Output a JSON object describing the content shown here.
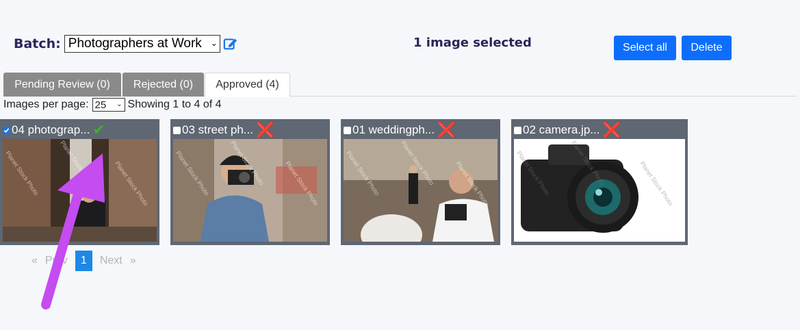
{
  "batch": {
    "label": "Batch:",
    "selected": "Photographers at Work"
  },
  "selection": {
    "status": "1 image selected"
  },
  "toolbar": {
    "select_all": "Select all",
    "delete": "Delete"
  },
  "tabs": [
    {
      "label": "Pending Review (0)",
      "active": false
    },
    {
      "label": "Rejected (0)",
      "active": false
    },
    {
      "label": "Approved (4)",
      "active": true
    }
  ],
  "listing": {
    "per_page_label": "Images per page:",
    "per_page_value": "25",
    "showing": "Showing 1 to 4 of 4"
  },
  "images": [
    {
      "title": "04 photograp...",
      "checked": true,
      "status_icon": "check-icon",
      "watermark": "Planet Stock Photo"
    },
    {
      "title": "03 street ph...",
      "checked": false,
      "status_icon": "cross-icon",
      "watermark": "Planet Stock Photo"
    },
    {
      "title": "01 weddingph...",
      "checked": false,
      "status_icon": "cross-icon",
      "watermark": "Planet Stock Photo"
    },
    {
      "title": "02 camera.jp...",
      "checked": false,
      "status_icon": "cross-icon",
      "watermark": "Planet Stock Photo"
    }
  ],
  "pagination": {
    "first": "«",
    "prev": "Prev",
    "current": "1",
    "next": "Next",
    "last": "»"
  },
  "colors": {
    "primary": "#0d6efd",
    "header_text": "#2c2458",
    "card_bg": "#5f6772",
    "approved": "#3caf2d",
    "rejected": "#e02020",
    "annotation_arrow": "#c44cf0"
  }
}
